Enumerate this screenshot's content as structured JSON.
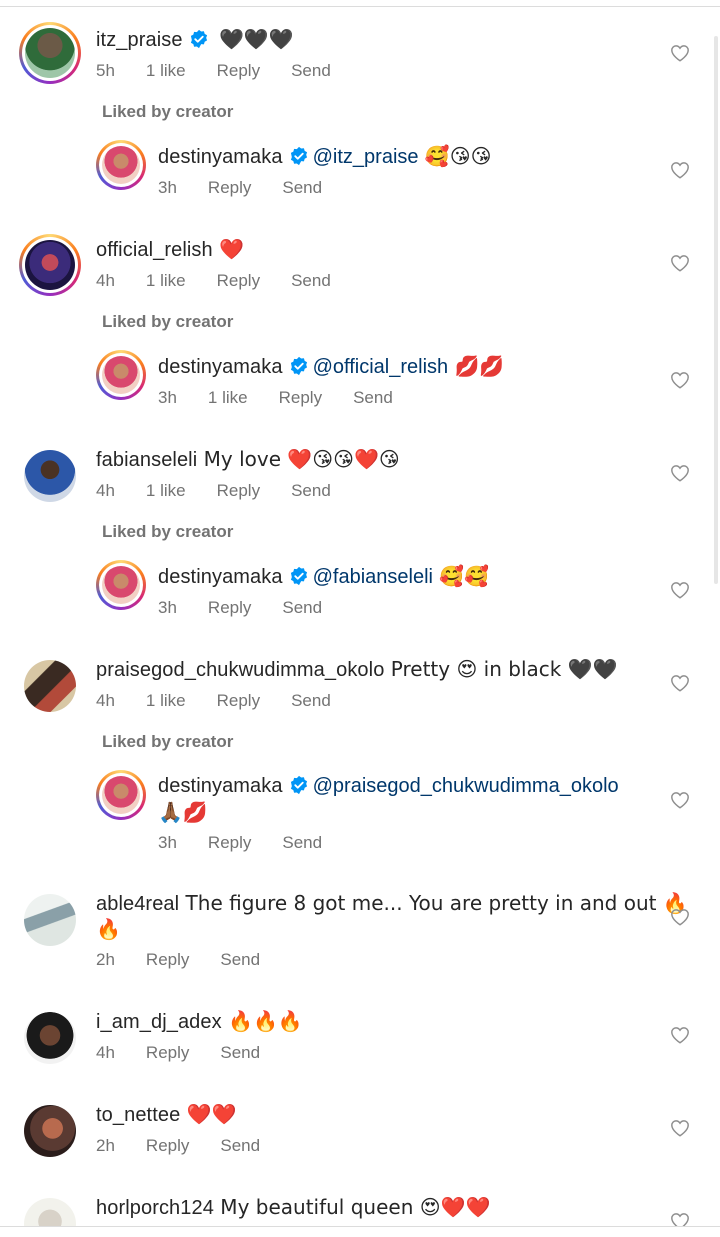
{
  "labels": {
    "reply": "Reply",
    "send": "Send",
    "liked_by_creator": "Liked by creator"
  },
  "colors": {
    "verified_blue": "#0095f6",
    "mention_blue": "#00376b",
    "meta_gray": "#737373"
  },
  "comments": [
    {
      "username": "itz_praise",
      "verified": true,
      "text": " 🖤🖤🖤",
      "time": "5h",
      "likes": "1 like",
      "avatar": "ring"
    },
    {
      "username": "destinyamaka",
      "verified": true,
      "mention": "@itz_praise",
      "text": " 🥰😘😘",
      "time": "3h",
      "likes": "",
      "reply": true
    },
    {
      "username": "official_relish",
      "verified": false,
      "text": " ❤️",
      "time": "4h",
      "likes": "1 like",
      "avatar": "ring"
    },
    {
      "username": "destinyamaka",
      "verified": true,
      "mention": "@official_relish",
      "text": " 💋💋",
      "time": "3h",
      "likes": "1 like",
      "reply": true
    },
    {
      "username": "fabianseleli",
      "verified": false,
      "text": " My love ❤️😘😘❤️😘",
      "time": "4h",
      "likes": "1 like"
    },
    {
      "username": "destinyamaka",
      "verified": true,
      "mention": "@fabianseleli",
      "text": " 🥰🥰",
      "time": "3h",
      "likes": "",
      "reply": true
    },
    {
      "username": "praisegod_chukwudimma_okolo",
      "verified": false,
      "text": " Pretty 😍 in black 🖤🖤",
      "time": "4h",
      "likes": "1 like"
    },
    {
      "username": "destinyamaka",
      "verified": true,
      "mention": "@praisegod_chukwudimma_okolo",
      "text2": "🙏🏾💋",
      "time": "3h",
      "likes": "",
      "reply": true
    },
    {
      "username": "able4real",
      "verified": false,
      "text": " The figure 8 got me... You are pretty in and out 🔥",
      "text2": "🔥",
      "time": "2h",
      "likes": ""
    },
    {
      "username": "i_am_dj_adex",
      "verified": false,
      "text": " 🔥🔥🔥",
      "time": "4h",
      "likes": ""
    },
    {
      "username": "to_nettee",
      "verified": false,
      "text": " ❤️❤️",
      "time": "2h",
      "likes": ""
    },
    {
      "username": "horlporch124",
      "verified": false,
      "text": " My beautiful queen 😍❤️❤️",
      "time": "",
      "likes": ""
    }
  ]
}
